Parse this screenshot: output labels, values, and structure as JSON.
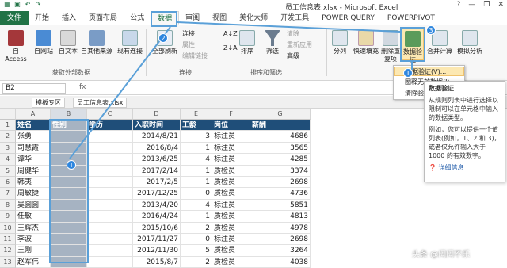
{
  "window": {
    "title": "员工信息表.xlsx - Microsoft Excel",
    "controls": [
      "?",
      "—",
      "❐",
      "✕"
    ]
  },
  "tabs": [
    "文件",
    "开始",
    "插入",
    "页面布局",
    "公式",
    "数据",
    "审阅",
    "视图",
    "美化大师",
    "开发工具",
    "POWER QUERY",
    "POWERPIVOT"
  ],
  "ribbon": {
    "get_external": {
      "access": "自 Access",
      "web": "自网站",
      "text": "自文本",
      "other": "自其他来源",
      "existing": "现有连接",
      "group": "获取外部数据"
    },
    "connections": {
      "refresh_all": "全部刷新",
      "conn": "连接",
      "props": "属性",
      "edit_links": "编辑链接",
      "group": "连接"
    },
    "sort_filter": {
      "sort_az": "A↓Z",
      "sort_za": "Z↓A",
      "sort": "排序",
      "filter": "筛选",
      "clear": "清除",
      "reapply": "重新应用",
      "advanced": "高级",
      "group": "排序和筛选"
    },
    "tools": {
      "split": "分列",
      "flash": "快速填充",
      "dedupe": "删除重复项",
      "validate": "数据验证",
      "consolidate": "合并计算",
      "whatif": "模拟分析"
    }
  },
  "popup": {
    "items": [
      "数据验证(V)...",
      "圈释无效数据(I)",
      "清除验证标识圈(R)"
    ]
  },
  "tooltip": {
    "title": "数据验证",
    "p1": "从规则列表中进行选择以限制可以在单元格中输入的数据类型。",
    "p2": "例如，您可以提供一个值列表(例如，1、2 和 3)，或者仅允许输入大于 1000 的有效数字。",
    "more": "详细信息"
  },
  "namebox": "B2",
  "fx": "fx",
  "sheet_tabs": [
    "模板专区",
    "员工信息表.xlsx"
  ],
  "columns": [
    "A",
    "B",
    "C",
    "D",
    "E",
    "F",
    "G"
  ],
  "headers": [
    "姓名",
    "性别",
    "学历",
    "入职时间",
    "工龄",
    "岗位",
    "薪酬"
  ],
  "rows": [
    {
      "name": "张勇",
      "date": "2014/8/21",
      "years": "3",
      "post": "标注员",
      "pay": "4686"
    },
    {
      "name": "司慧霞",
      "date": "2016/8/4",
      "years": "1",
      "post": "标注员",
      "pay": "3565"
    },
    {
      "name": "谭华",
      "date": "2013/6/25",
      "years": "4",
      "post": "标注员",
      "pay": "4285"
    },
    {
      "name": "周健华",
      "date": "2017/2/14",
      "years": "1",
      "post": "质检员",
      "pay": "3374"
    },
    {
      "name": "韩夷",
      "date": "2017/2/5",
      "years": "1",
      "post": "质检员",
      "pay": "2698"
    },
    {
      "name": "周敏捷",
      "date": "2017/12/25",
      "years": "0",
      "post": "质检员",
      "pay": "4736"
    },
    {
      "name": "吴圆圆",
      "date": "2013/4/20",
      "years": "4",
      "post": "标注员",
      "pay": "5851"
    },
    {
      "name": "任敏",
      "date": "2016/4/24",
      "years": "1",
      "post": "质检员",
      "pay": "4813"
    },
    {
      "name": "王辉杰",
      "date": "2015/10/6",
      "years": "2",
      "post": "质检员",
      "pay": "4978"
    },
    {
      "name": "李波",
      "date": "2017/11/27",
      "years": "0",
      "post": "标注员",
      "pay": "2698"
    },
    {
      "name": "王刚",
      "date": "2012/11/30",
      "years": "5",
      "post": "质检员",
      "pay": "3264"
    },
    {
      "name": "赵军伟",
      "date": "2015/8/7",
      "years": "2",
      "post": "质检员",
      "pay": "4038"
    }
  ],
  "badges": [
    "1",
    "2",
    "3",
    "4",
    "1"
  ],
  "watermark": "头条 @闷闷不乐",
  "colors": {
    "excel_green": "#217346",
    "header_fill": "#1f4e79",
    "selection": "#a6b3c2",
    "callout": "#5aa0d8"
  }
}
